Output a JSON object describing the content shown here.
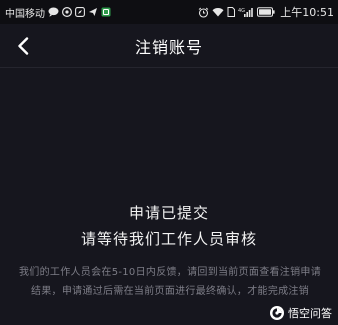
{
  "status_bar": {
    "carrier": "中国移动",
    "signal_label": "4G",
    "time": "上午10:51"
  },
  "header": {
    "title": "注销账号"
  },
  "main": {
    "headline_line1": "申请已提交",
    "headline_line2": "请等待我们工作人员审核",
    "description": "我们的工作人员会在5-10日内反馈，请回到当前页面查看注销申请结果，申请通过后需在当前页面进行最终确认，才能完成注销"
  },
  "watermark": {
    "text": "悟空问答"
  },
  "colors": {
    "background": "#16161e",
    "status_bar": "#0e0e12",
    "text_primary": "#f2f2f2",
    "text_secondary": "#7d7d87"
  }
}
